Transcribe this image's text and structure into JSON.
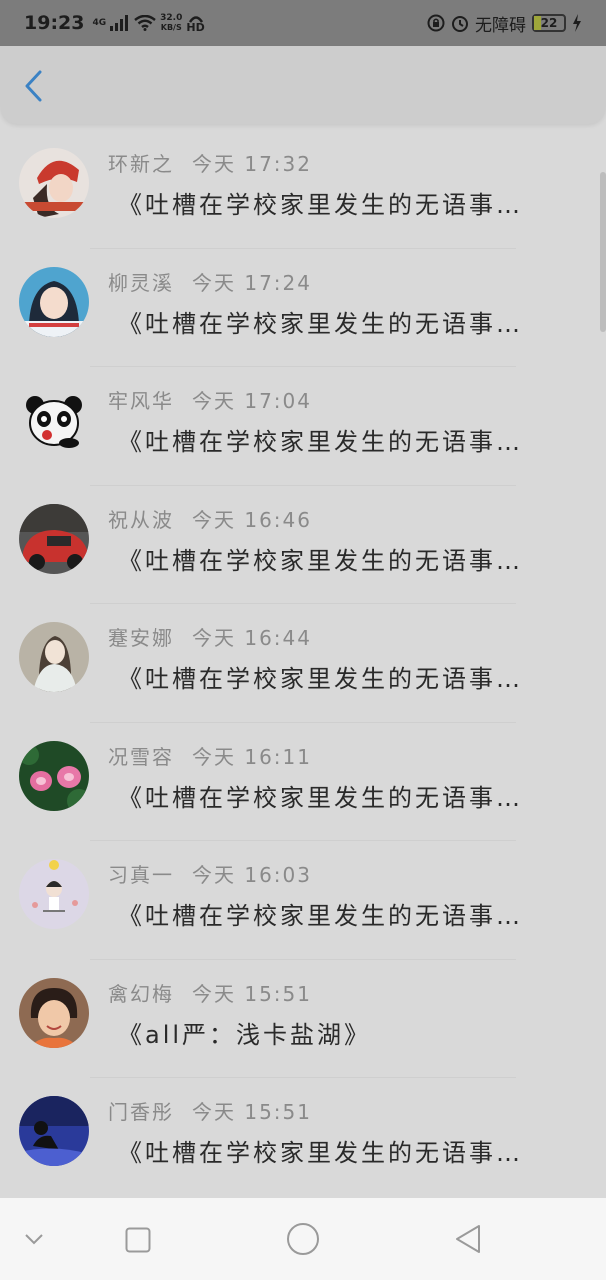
{
  "status_bar": {
    "time": "19:23",
    "network": "4G",
    "speed_value": "32.0",
    "speed_unit": "KB/S",
    "hd": "HD",
    "accessibility": "无障碍",
    "battery": "22",
    "battery_level": 0.22,
    "battery_color": "#9ea63a"
  },
  "messages": [
    {
      "name": "环新之",
      "time": "今天 17:32",
      "text": "《吐槽在学校家里发生的无语事…",
      "avatar": "avatar-girl-red-hat"
    },
    {
      "name": "柳灵溪",
      "time": "今天 17:24",
      "text": "《吐槽在学校家里发生的无语事…",
      "avatar": "avatar-girl-blue"
    },
    {
      "name": "牢风华",
      "time": "今天 17:04",
      "text": "《吐槽在学校家里发生的无语事…",
      "avatar": "avatar-panda"
    },
    {
      "name": "祝从波",
      "time": "今天 16:46",
      "text": "《吐槽在学校家里发生的无语事…",
      "avatar": "avatar-red-car"
    },
    {
      "name": "蹇安娜",
      "time": "今天 16:44",
      "text": "《吐槽在学校家里发生的无语事…",
      "avatar": "avatar-girl-white-dress"
    },
    {
      "name": "况雪容",
      "time": "今天 16:11",
      "text": "《吐槽在学校家里发生的无语事…",
      "avatar": "avatar-lotus"
    },
    {
      "name": "习真一",
      "time": "今天 16:03",
      "text": "《吐槽在学校家里发生的无语事…",
      "avatar": "avatar-cartoon"
    },
    {
      "name": "禽幻梅",
      "time": "今天 15:51",
      "text": "《all严：浅卡盐湖》",
      "avatar": "avatar-boy"
    },
    {
      "name": "门香彤",
      "time": "今天 15:51",
      "text": "《吐槽在学校家里发生的无语事…",
      "avatar": "avatar-night-sky"
    }
  ],
  "colors": {
    "accent": "#3b82c4",
    "background": "#d9d9d9",
    "status_bar": "#7c7c7c"
  }
}
